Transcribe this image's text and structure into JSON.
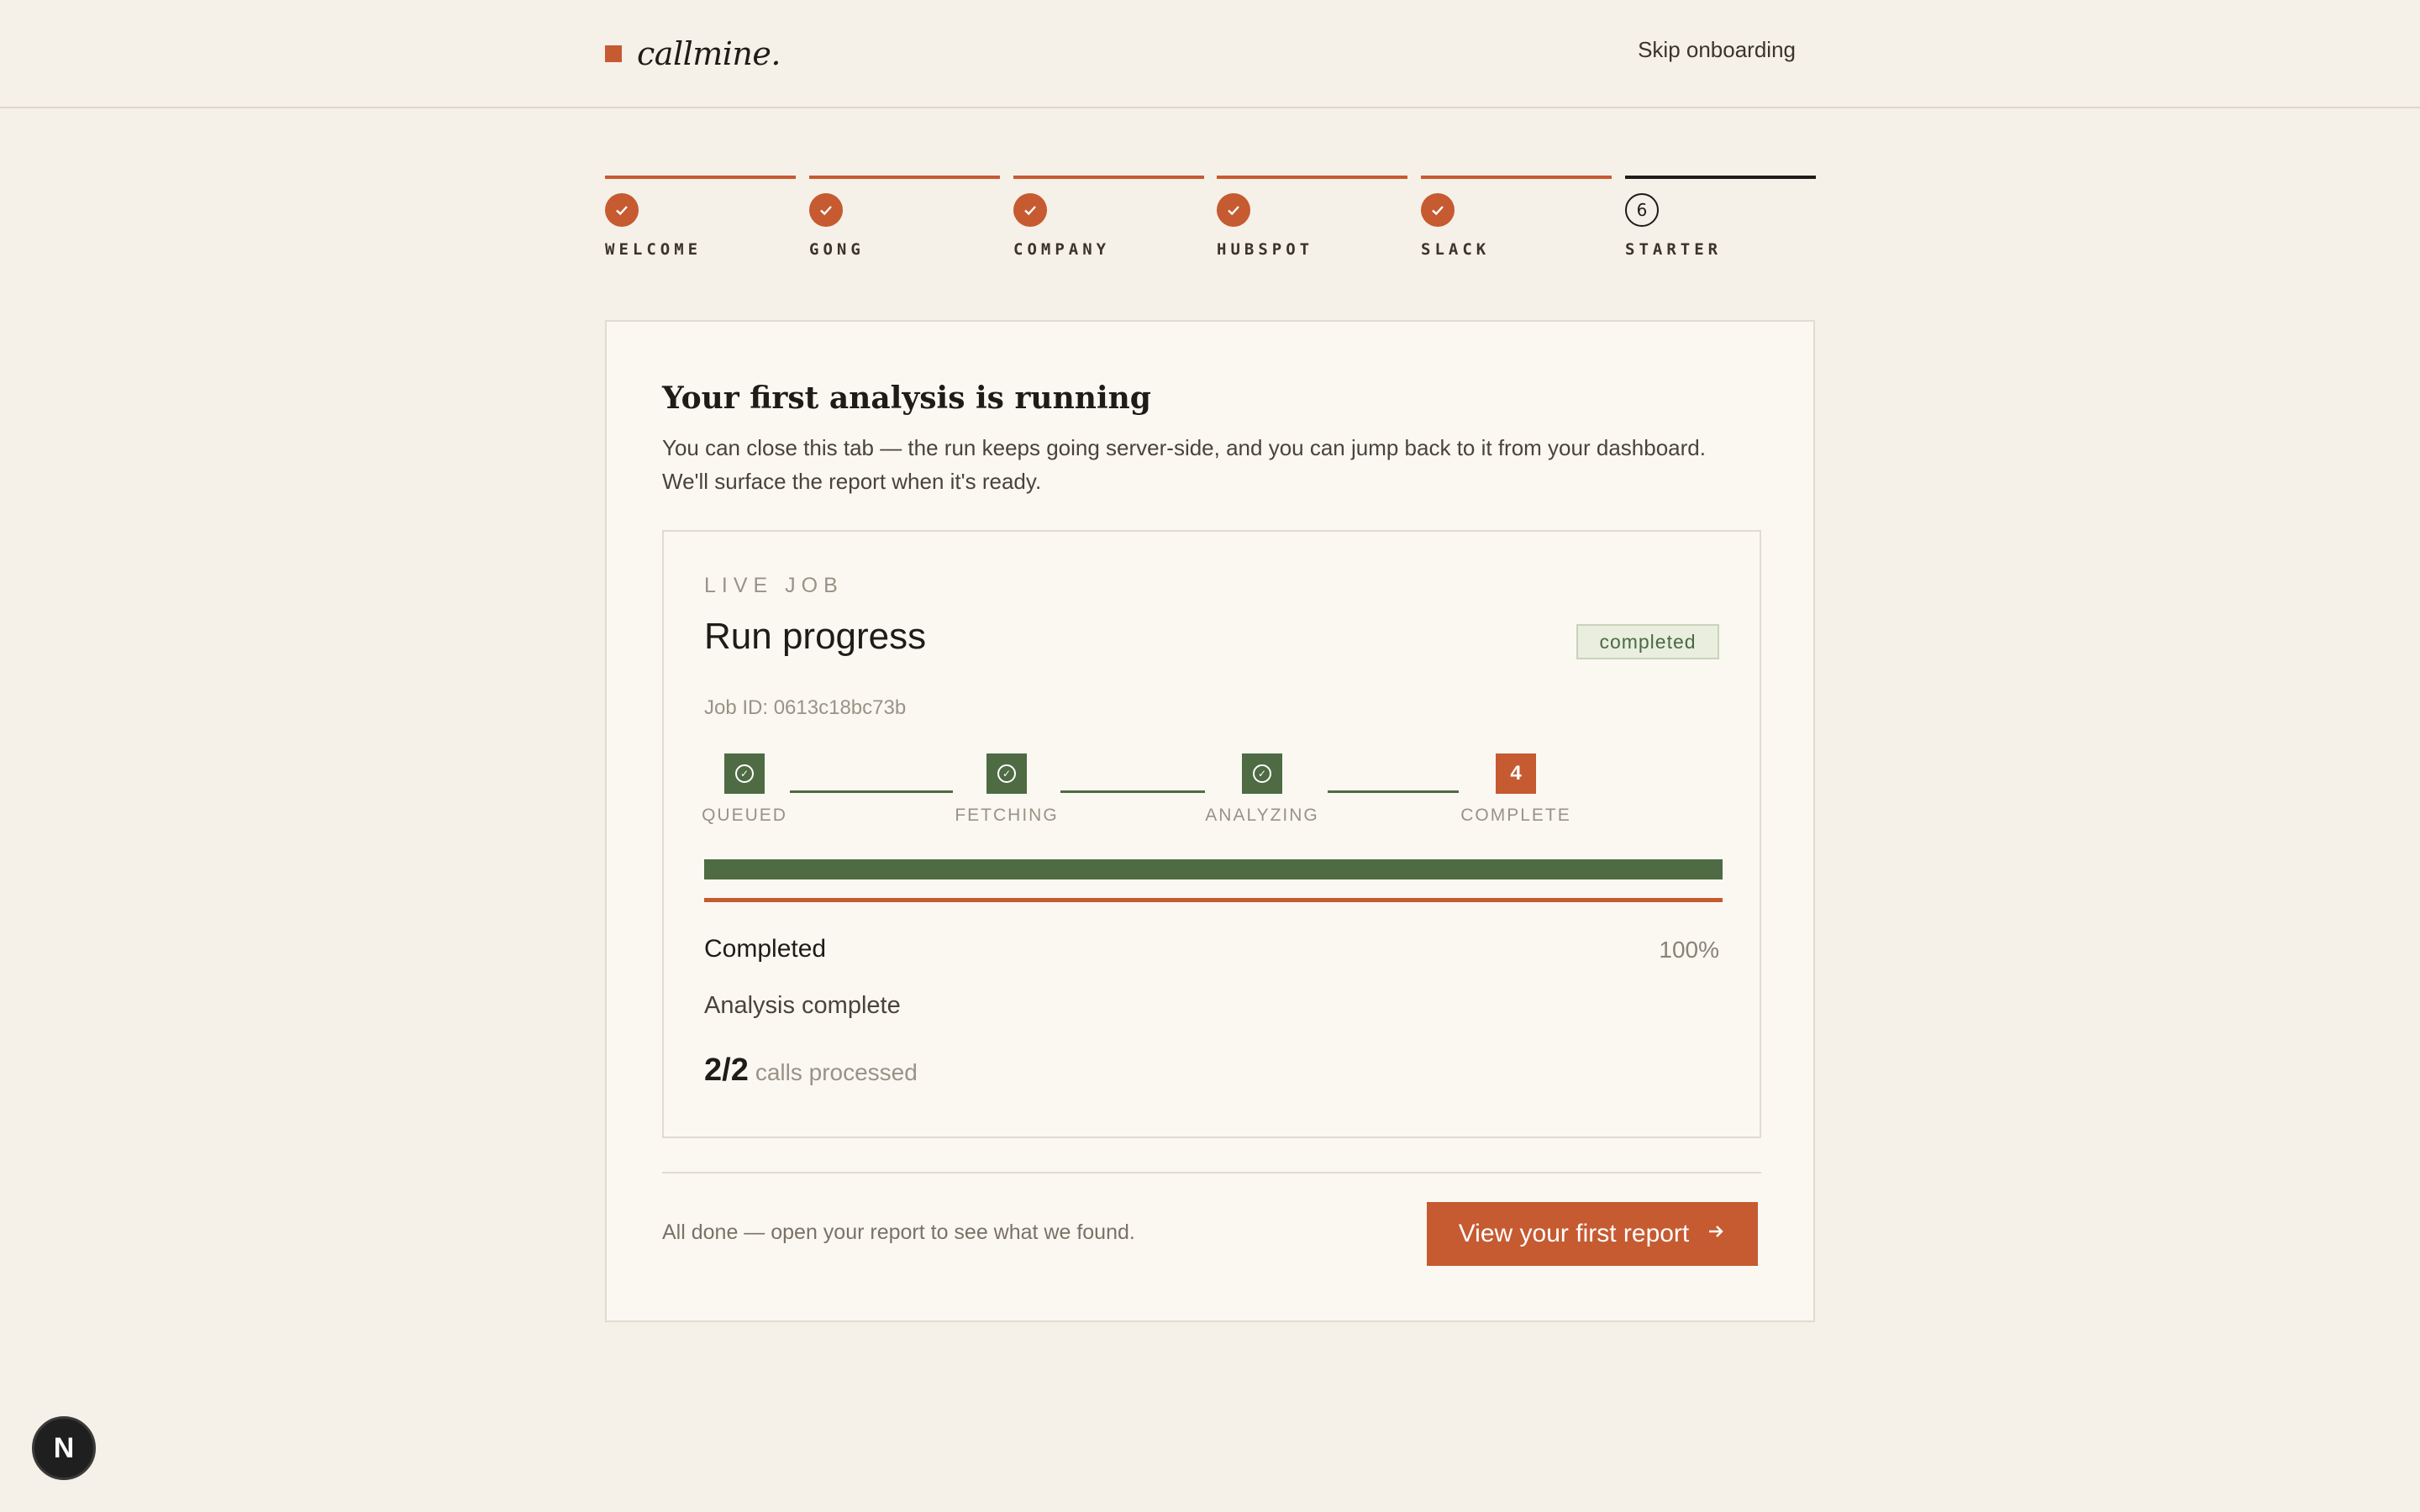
{
  "header": {
    "logo_text": "callmine.",
    "skip_label": "Skip onboarding"
  },
  "onboarding_steps": [
    {
      "label": "WELCOME",
      "status": "done",
      "icon": "check-icon"
    },
    {
      "label": "GONG",
      "status": "done",
      "icon": "check-icon"
    },
    {
      "label": "COMPANY",
      "status": "done",
      "icon": "check-icon"
    },
    {
      "label": "HUBSPOT",
      "status": "done",
      "icon": "check-icon"
    },
    {
      "label": "SLACK",
      "status": "done",
      "icon": "check-icon"
    },
    {
      "label": "STARTER",
      "status": "current",
      "number": "6"
    }
  ],
  "card": {
    "title": "Your first analysis is running",
    "description": "You can close this tab — the run keeps going server-side, and you can jump back to it from your dashboard. We'll surface the report when it's ready."
  },
  "job": {
    "eyebrow": "LIVE JOB",
    "title": "Run progress",
    "status": "completed",
    "job_id": "Job ID: 0613c18bc73b",
    "stages": [
      {
        "label": "QUEUED",
        "status": "done",
        "icon": "check-circle-icon"
      },
      {
        "label": "FETCHING",
        "status": "done",
        "icon": "check-circle-icon"
      },
      {
        "label": "ANALYZING",
        "status": "done",
        "icon": "check-circle-icon"
      },
      {
        "label": "COMPLETE",
        "status": "current",
        "number": "4"
      }
    ],
    "progress_fraction": 1.0,
    "state_label": "Completed",
    "percent_label": "100%",
    "message": "Analysis complete",
    "calls_count": "2/2",
    "calls_label": "calls processed"
  },
  "footer": {
    "note": "All done — open your report to see what we found.",
    "cta_label": "View your first report"
  },
  "dev_badge": {
    "label": "N"
  },
  "colors": {
    "accent": "#c65a31",
    "success": "#4e6b43",
    "background": "#f5f0e8",
    "card": "#fbf8f2"
  }
}
